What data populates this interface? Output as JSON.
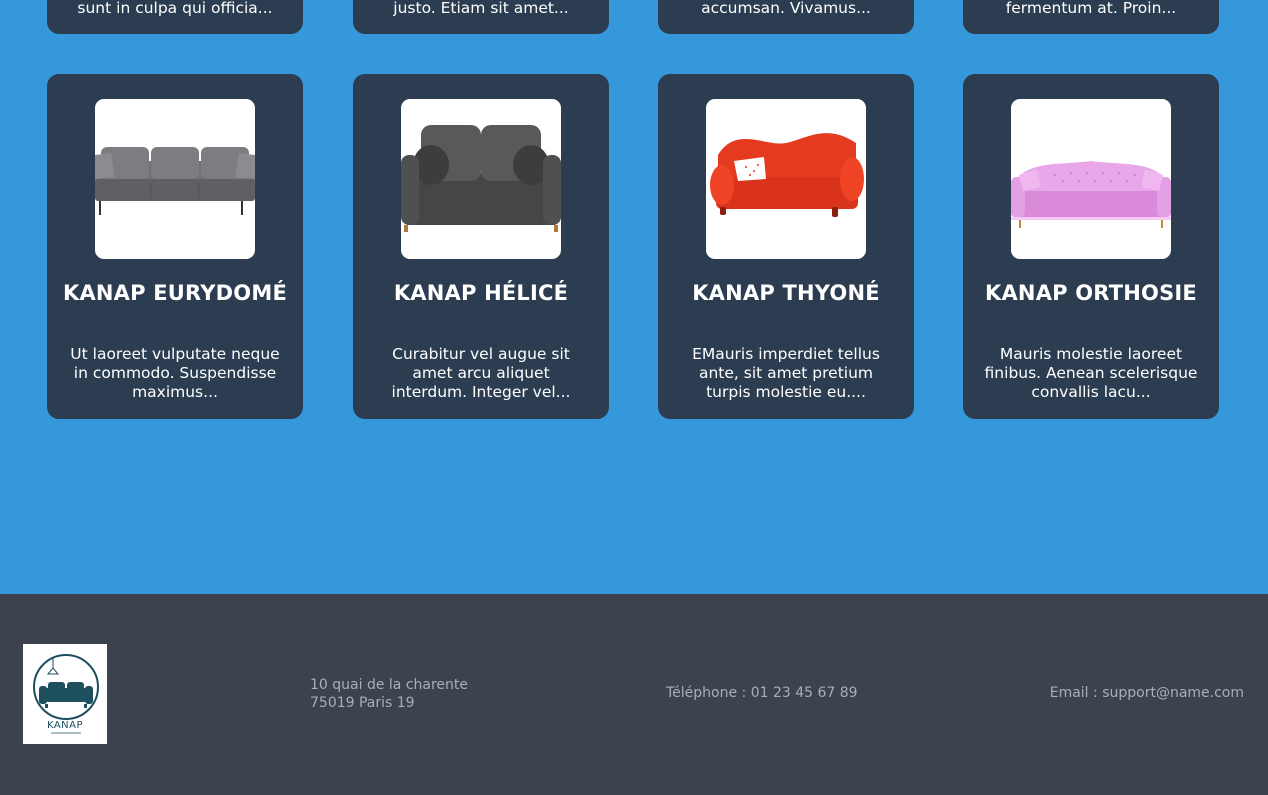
{
  "top_cards": [
    {
      "description": "sunt in culpa qui officia..."
    },
    {
      "description": "justo. Etiam sit amet..."
    },
    {
      "description": "accumsan. Vivamus..."
    },
    {
      "description": "fermentum at. Proin..."
    }
  ],
  "products": [
    {
      "name": "KANAP EURYDOMÉ",
      "description": "Ut laoreet vulputate neque in commodo. Suspendisse maximus...",
      "image": "grey-sofa-image",
      "color": "#6b6d70"
    },
    {
      "name": "KANAP HÉLICÉ",
      "description": "Curabitur vel augue sit amet arcu aliquet interdum. Integer vel...",
      "image": "dark-grey-sofa-image",
      "color": "#4a4b4d"
    },
    {
      "name": "KANAP THYONÉ",
      "description": "EMauris imperdiet tellus ante, sit amet pretium turpis molestie eu....",
      "image": "red-sofa-image",
      "color": "#e8361c"
    },
    {
      "name": "KANAP ORTHOSIE",
      "description": "Mauris molestie laoreet finibus. Aenean scelerisque convallis lacu...",
      "image": "pink-sofa-image",
      "color": "#e39be3"
    }
  ],
  "footer": {
    "logo_text": "KANAP",
    "address_line1": "10 quai de la charente",
    "address_line2": "75019 Paris 19",
    "phone": "Téléphone : 01 23 45 67 89",
    "email": "Email : support@name.com"
  },
  "colors": {
    "background": "#3498db",
    "card": "#2c3d52",
    "footer": "#3d424f",
    "footer_text": "#a9adb6",
    "logo_teal": "#1d4f5e"
  }
}
